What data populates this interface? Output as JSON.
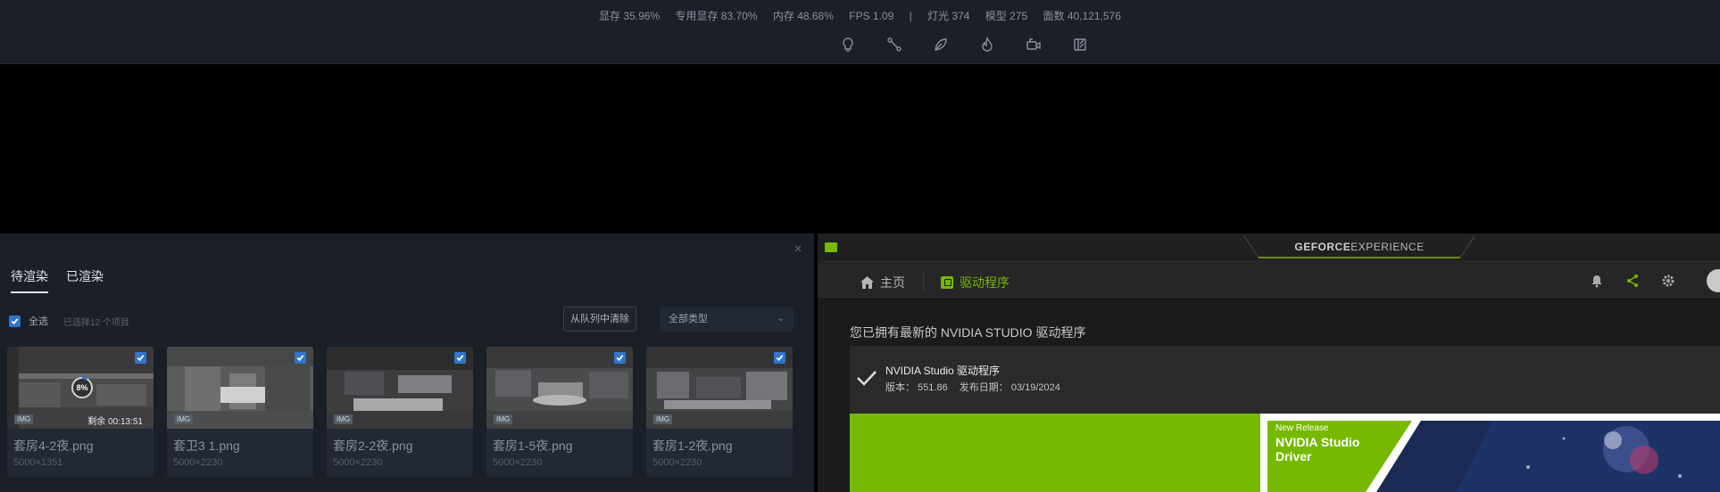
{
  "stats": {
    "vram": "显存 35.96%",
    "dedicated_vram": "专用显存 83.70%",
    "memory": "内存 48.68%",
    "fps": "FPS 1.09",
    "separator": "|",
    "lights": "灯光 374",
    "models": "模型 275",
    "faces": "面数 40,121,576"
  },
  "toolbar_icons": [
    "bulb-icon",
    "path-icon",
    "leaf-icon",
    "flame-icon",
    "camera-icon",
    "panel-icon"
  ],
  "queue": {
    "tabs": [
      {
        "label": "待渲染",
        "active": true
      },
      {
        "label": "已渲染",
        "active": false
      }
    ],
    "select_all": "全选",
    "selected_count": "已选择12 个项目",
    "clear_button": "从队列中清除",
    "type_select": "全部类型",
    "cards": [
      {
        "name": "套房4-2夜.png",
        "size": "5000×1351",
        "badge": "IMG",
        "progress": "8%",
        "remaining": "剩余  00:13:51",
        "checked": true
      },
      {
        "name": "套卫3 1.png",
        "size": "5000×2230",
        "badge": "IMG",
        "checked": true
      },
      {
        "name": "套房2-2夜.png",
        "size": "5000×2230",
        "badge": "IMG",
        "checked": true
      },
      {
        "name": "套房1-5夜.png",
        "size": "5000×2230",
        "badge": "IMG",
        "checked": true
      },
      {
        "name": "套房1-2夜.png",
        "size": "5000×2230",
        "badge": "IMG",
        "checked": true
      }
    ]
  },
  "gfe": {
    "brand_bold": "GEFORCE",
    "brand_light": "EXPERIENCE",
    "nav_home": "主页",
    "nav_drivers": "驱动程序",
    "up_to_date": "您已拥有最新的 NVIDIA STUDIO 驱动程序",
    "driver_name": "NVIDIA Studio 驱动程序",
    "version": "版本： 551.86",
    "release_date": "发布日期： 03/19/2024",
    "banner_label": "New Release",
    "banner_title_1": "NVIDIA Studio",
    "banner_title_2": "Driver",
    "accent": "#76b900"
  }
}
